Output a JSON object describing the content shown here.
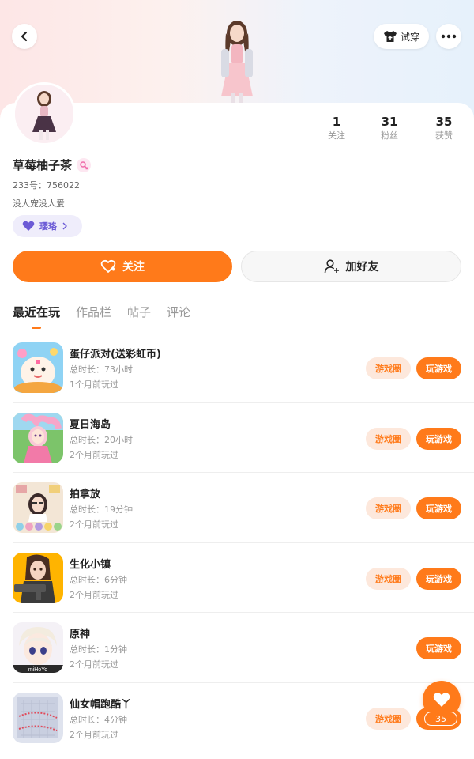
{
  "header": {
    "tryon_label": "试穿"
  },
  "profile": {
    "username": "草莓柚子茶",
    "uid": "233号：756022",
    "bio": "没人宠没人爱",
    "badge_label": "璎珞",
    "stats": [
      {
        "value": "1",
        "label": "关注"
      },
      {
        "value": "31",
        "label": "粉丝"
      },
      {
        "value": "35",
        "label": "获赞"
      }
    ]
  },
  "actions": {
    "follow_label": "关注",
    "add_friend_label": "加好友"
  },
  "tabs": [
    {
      "label": "最近在玩",
      "active": true
    },
    {
      "label": "作品栏",
      "active": false
    },
    {
      "label": "帖子",
      "active": false
    },
    {
      "label": "评论",
      "active": false
    }
  ],
  "games": [
    {
      "name": "蛋仔派对(送彩虹币)",
      "duration": "总时长：73小时",
      "last_played": "1个月前玩过",
      "circle_label": "游戏圈",
      "play_label": "玩游戏",
      "has_circle": true,
      "icon": "eggy-party-icon"
    },
    {
      "name": "夏日海岛",
      "duration": "总时长：20小时",
      "last_played": "2个月前玩过",
      "circle_label": "游戏圈",
      "play_label": "玩游戏",
      "has_circle": true,
      "icon": "summer-island-icon"
    },
    {
      "name": "拍拿放",
      "duration": "总时长：19分钟",
      "last_played": "2个月前玩过",
      "circle_label": "游戏圈",
      "play_label": "玩游戏",
      "has_circle": true,
      "icon": "pai-na-fang-icon"
    },
    {
      "name": "生化小镇",
      "duration": "总时长：6分钟",
      "last_played": "2个月前玩过",
      "circle_label": "游戏圈",
      "play_label": "玩游戏",
      "has_circle": true,
      "icon": "biochem-town-icon"
    },
    {
      "name": "原神",
      "duration": "总时长：1分钟",
      "last_played": "2个月前玩过",
      "circle_label": "",
      "play_label": "玩游戏",
      "has_circle": false,
      "icon": "genshin-icon"
    },
    {
      "name": "仙女帽跑酷丫",
      "duration": "总时长：4分钟",
      "last_played": "2个月前玩过",
      "circle_label": "游戏圈",
      "play_label": "玩游戏",
      "has_circle": true,
      "icon": "fairy-hat-parkour-icon"
    }
  ],
  "like": {
    "count": "35"
  },
  "colors": {
    "accent": "#ff7a1a",
    "accent_light": "#fde8dc",
    "badge_purple": "#6c5bd6"
  }
}
